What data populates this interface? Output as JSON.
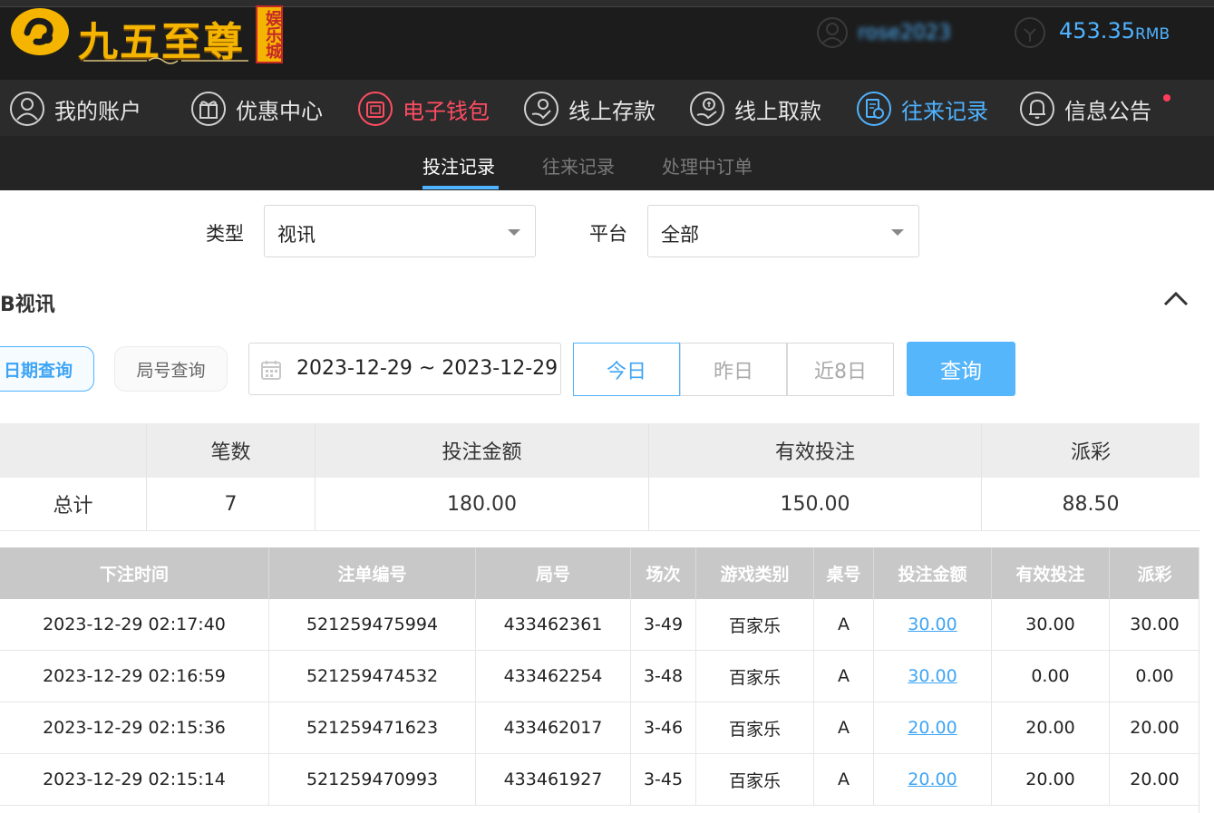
{
  "header": {
    "logo_text": "九五至尊",
    "logo_sub": "娱乐城",
    "username": "rose2023",
    "balance": "453.35",
    "currency": "RMB"
  },
  "nav": {
    "items": [
      {
        "label": "我的账户",
        "icon": "user-icon"
      },
      {
        "label": "优惠中心",
        "icon": "gift-icon"
      },
      {
        "label": "电子钱包",
        "icon": "wallet-icon"
      },
      {
        "label": "线上存款",
        "icon": "deposit-icon"
      },
      {
        "label": "线上取款",
        "icon": "withdraw-icon"
      },
      {
        "label": "往来记录",
        "icon": "records-icon"
      },
      {
        "label": "信息公告",
        "icon": "bell-icon"
      }
    ]
  },
  "sub_tabs": [
    "投注记录",
    "往来记录",
    "处理中订单"
  ],
  "filters": {
    "type_label": "类型",
    "type_value": "视讯",
    "platform_label": "平台",
    "platform_value": "全部"
  },
  "section_title": "B视讯",
  "query": {
    "date_mode": "日期查询",
    "round_mode": "局号查询",
    "date_range": "2023-12-29 ~ 2023-12-29",
    "quick": [
      "今日",
      "昨日",
      "近8日"
    ],
    "submit": "查询"
  },
  "summary": {
    "headers": [
      "",
      "笔数",
      "投注金额",
      "有效投注",
      "派彩"
    ],
    "row": [
      "总计",
      "7",
      "180.00",
      "150.00",
      "88.50"
    ]
  },
  "records": {
    "headers": [
      "下注时间",
      "注单编号",
      "局号",
      "场次",
      "游戏类别",
      "桌号",
      "投注金额",
      "有效投注",
      "派彩"
    ],
    "rows": [
      [
        "2023-12-29 02:17:40",
        "521259475994",
        "433462361",
        "3-49",
        "百家乐",
        "A",
        "30.00",
        "30.00",
        "30.00"
      ],
      [
        "2023-12-29 02:16:59",
        "521259474532",
        "433462254",
        "3-48",
        "百家乐",
        "A",
        "30.00",
        "0.00",
        "0.00"
      ],
      [
        "2023-12-29 02:15:36",
        "521259471623",
        "433462017",
        "3-46",
        "百家乐",
        "A",
        "20.00",
        "20.00",
        "20.00"
      ],
      [
        "2023-12-29 02:15:14",
        "521259470993",
        "433461927",
        "3-45",
        "百家乐",
        "A",
        "20.00",
        "20.00",
        "20.00"
      ]
    ]
  },
  "colors": {
    "accent": "#4fb3ff",
    "alert": "#ff4d63",
    "header_bg": "#1c1c1c",
    "nav_bg": "#2b2b2b"
  }
}
